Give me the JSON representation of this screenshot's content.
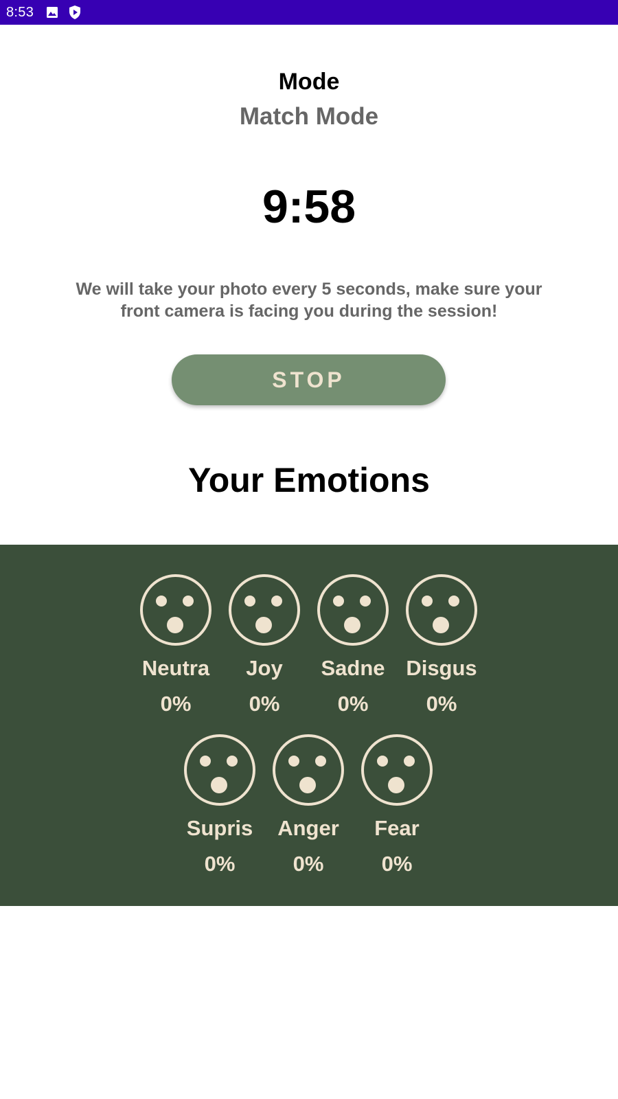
{
  "status_bar": {
    "time": "8:53",
    "icons": [
      "image-icon",
      "shield-play-icon"
    ]
  },
  "mode": {
    "label": "Mode",
    "value": "Match Mode"
  },
  "timer": "9:58",
  "info_text": "We will take your photo every 5 seconds, make sure your front camera is facing you during the session!",
  "stop_button": "STOP",
  "emotions_title": "Your Emotions",
  "colors": {
    "status_bar": "#3700b3",
    "button": "#758f72",
    "panel": "#3b4f3a",
    "panel_text": "#efe3cf"
  },
  "emotions": [
    {
      "label": "Neutra",
      "percent": "0%",
      "icon": "surprised-face-icon"
    },
    {
      "label": "Joy",
      "percent": "0%",
      "icon": "surprised-face-icon"
    },
    {
      "label": "Sadne",
      "percent": "0%",
      "icon": "surprised-face-icon"
    },
    {
      "label": "Disgus",
      "percent": "0%",
      "icon": "surprised-face-icon"
    },
    {
      "label": "Supris",
      "percent": "0%",
      "icon": "surprised-face-icon"
    },
    {
      "label": "Anger",
      "percent": "0%",
      "icon": "surprised-face-icon"
    },
    {
      "label": "Fear",
      "percent": "0%",
      "icon": "surprised-face-icon"
    }
  ]
}
